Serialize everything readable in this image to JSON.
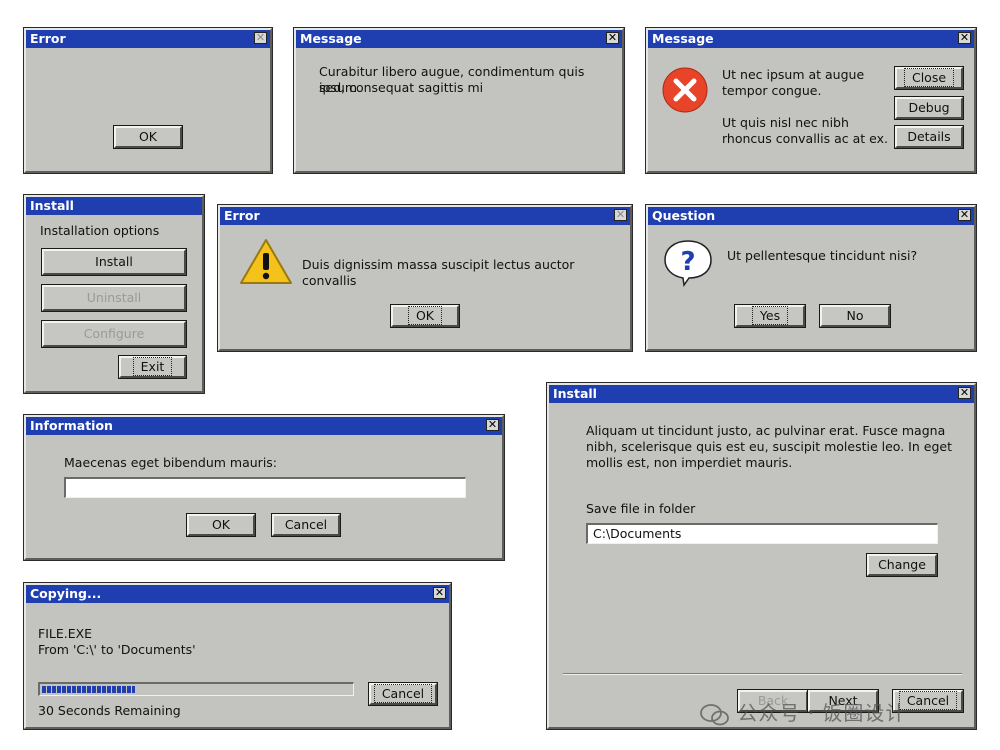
{
  "error1": {
    "title": "Error",
    "ok": "OK"
  },
  "message1": {
    "title": "Message",
    "text1": "Curabitur libero augue, condimentum quis ipsum",
    "text2": "sed, consequat sagittis mi"
  },
  "message2": {
    "title": "Message",
    "line1": "Ut nec ipsum at augue",
    "line2": "tempor congue.",
    "line3": "Ut quis nisl nec nibh",
    "line4": "rhoncus convallis ac at ex.",
    "close": "Close",
    "debug": "Debug",
    "details": "Details"
  },
  "install1": {
    "title": "Install",
    "heading": "Installation options",
    "install": "Install",
    "uninstall": "Uninstall",
    "configure": "Configure",
    "exit": "Exit"
  },
  "error2": {
    "title": "Error",
    "text": "Duis dignissim massa suscipit lectus auctor convallis",
    "ok": "OK"
  },
  "question": {
    "title": "Question",
    "text": "Ut pellentesque tincidunt nisi?",
    "yes": "Yes",
    "no": "No"
  },
  "information": {
    "title": "Information",
    "label": "Maecenas eget bibendum mauris:",
    "value": "",
    "ok": "OK",
    "cancel": "Cancel"
  },
  "install2": {
    "title": "Install",
    "para1": "Aliquam ut tincidunt justo, ac pulvinar erat. Fusce magna",
    "para2": "nibh, scelerisque quis est eu, suscipit molestie leo. In eget",
    "para3": "mollis est, non imperdiet mauris.",
    "folder_label": "Save file in folder",
    "folder_value": "C:\\Documents",
    "change": "Change",
    "back": "Back",
    "next": "Next",
    "cancel": "Cancel"
  },
  "copying": {
    "title": "Copying...",
    "file": "FILE.EXE",
    "from": "From 'C:\\' to 'Documents'",
    "remaining": "30 Seconds Remaining",
    "cancel": "Cancel",
    "progress_fraction": 0.3
  },
  "watermark": "公众号 · 饭圈设计",
  "colors": {
    "title_bar": "#1f3fb0",
    "window_bg": "#c3c3bf",
    "progress": "#1f3fb0",
    "error_icon": "#e8442a",
    "warning_icon": "#f5c21b"
  }
}
